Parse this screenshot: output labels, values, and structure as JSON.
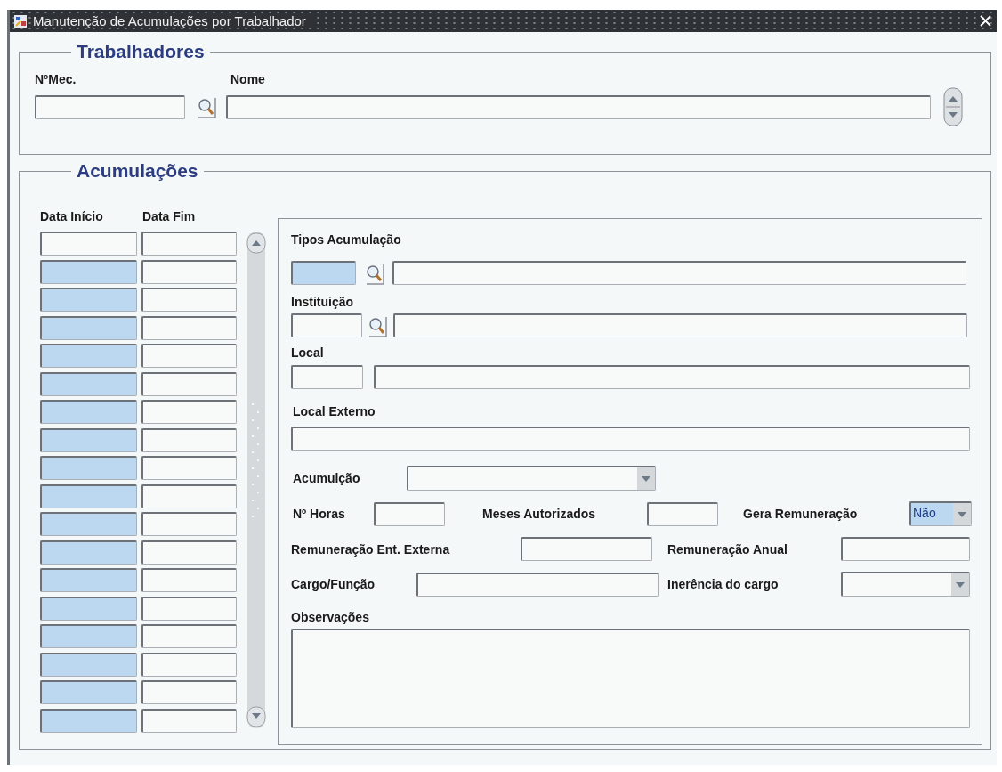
{
  "window": {
    "title": "Manutenção de Acumulações por Trabalhador"
  },
  "trabalhadores": {
    "title": "Trabalhadores",
    "numero_label": "NºMec.",
    "nome_label": "Nome"
  },
  "acumulacoes": {
    "title": "Acumulações",
    "columns": [
      "Data Início",
      "Data Fim"
    ],
    "rows": [
      {
        "highlighted": false
      },
      {
        "highlighted": true
      },
      {
        "highlighted": true
      },
      {
        "highlighted": true
      },
      {
        "highlighted": true
      },
      {
        "highlighted": true
      },
      {
        "highlighted": true
      },
      {
        "highlighted": true
      },
      {
        "highlighted": true
      },
      {
        "highlighted": true
      },
      {
        "highlighted": true
      },
      {
        "highlighted": true
      },
      {
        "highlighted": true
      },
      {
        "highlighted": true
      },
      {
        "highlighted": true
      },
      {
        "highlighted": true
      },
      {
        "highlighted": true
      },
      {
        "highlighted": true
      }
    ]
  },
  "detail": {
    "tipos_acumulacao": {
      "label": "Tipos Acumulação",
      "highlighted": true
    },
    "instituicao": {
      "label": "Instituição"
    },
    "local": {
      "label": "Local"
    },
    "local_externo": {
      "label": "Local Externo"
    },
    "acumulacao": {
      "label": "Acumulção"
    },
    "horas": {
      "label": "Nº Horas"
    },
    "meses_autorizados": {
      "label": "Meses Autorizados"
    },
    "gera_remuneracao": {
      "label": "Gera Remuneração",
      "value": "Não",
      "highlighted": true
    },
    "remuneracao_externa": {
      "label": "Remuneração Ent. Externa"
    },
    "remuneracao_anual": {
      "label": "Remuneração Anual"
    },
    "cargo_funcao": {
      "label": "Cargo/Função"
    },
    "inerencia": {
      "label": "Inerência do cargo"
    },
    "observacoes": {
      "label": "Observações"
    }
  }
}
